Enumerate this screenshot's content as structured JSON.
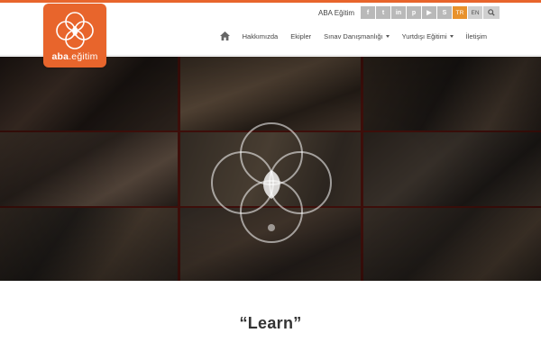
{
  "brand": {
    "logo_text_bold": "aba",
    "logo_text_rest": ".eğitim",
    "accent_color": "#e8652c",
    "language_active_color": "#e8922c"
  },
  "utility": {
    "company_link": "ABA Eğitim",
    "social": [
      {
        "icon": "facebook-icon",
        "glyph": "f"
      },
      {
        "icon": "twitter-icon",
        "glyph": "t"
      },
      {
        "icon": "linkedin-icon",
        "glyph": "in"
      },
      {
        "icon": "pinterest-icon",
        "glyph": "p"
      },
      {
        "icon": "youtube-icon",
        "glyph": "▶"
      },
      {
        "icon": "skype-icon",
        "glyph": "S"
      }
    ],
    "languages": [
      {
        "code": "TR",
        "active": true
      },
      {
        "code": "EN",
        "active": false
      }
    ],
    "search_icon": "search-icon"
  },
  "nav": {
    "home_icon": "home-icon",
    "items": [
      {
        "label": "Hakkımızda",
        "dropdown": false
      },
      {
        "label": "Ekipler",
        "dropdown": false
      },
      {
        "label": "Sınav Danışmanlığı",
        "dropdown": true
      },
      {
        "label": "Yurtdışı Eğitimi",
        "dropdown": true
      },
      {
        "label": "İletişim",
        "dropdown": false
      }
    ]
  },
  "hero": {
    "emblem_icon": "flower-of-life-logo-icon",
    "photo_description_icon": "classroom-photo-grid"
  },
  "content": {
    "title": "“Learn”"
  }
}
